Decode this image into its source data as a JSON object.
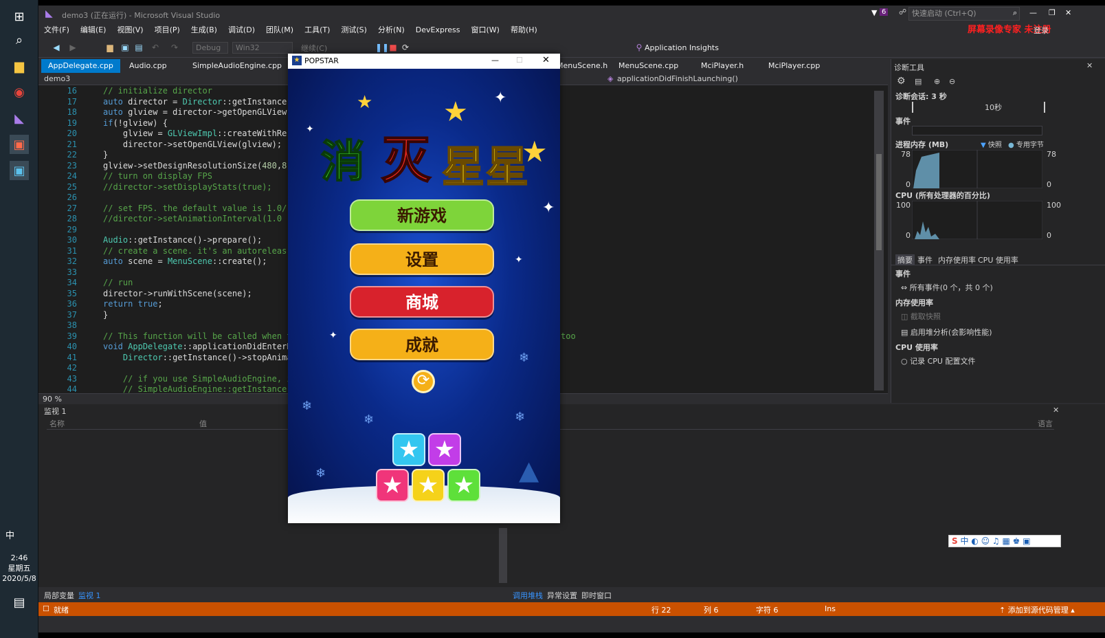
{
  "taskbar": {
    "clock_time": "2:46",
    "clock_day": "星期五",
    "clock_date": "2020/5/8",
    "ime_label": "中"
  },
  "titlebar": {
    "title": "demo3 (正在运行) - Microsoft Visual Studio",
    "notification_count": "6",
    "quick_launch_placeholder": "快速启动 (Ctrl+Q)",
    "watermark": "屏幕录像专家 未注册",
    "login_label": "登录"
  },
  "menu": [
    "文件(F)",
    "编辑(E)",
    "视图(V)",
    "项目(P)",
    "生成(B)",
    "调试(D)",
    "团队(M)",
    "工具(T)",
    "测试(S)",
    "分析(N)",
    "DevExpress",
    "窗口(W)",
    "帮助(H)"
  ],
  "toolbar": {
    "config": "Debug",
    "platform": "Win32",
    "continue_label": "继续(C)",
    "app_insights": "Application Insights"
  },
  "doc_tabs": [
    "AppDelegate.cpp",
    "Audio.cpp",
    "SimpleAudioEngine.cpp",
    "MenuScene.h",
    "MenuScene.cpp",
    "MciPlayer.h",
    "MciPlayer.cpp"
  ],
  "navbar": {
    "project": "demo3",
    "member": "applicationDidFinishLaunching()"
  },
  "code_lines": [
    {
      "n": "16",
      "html": "<span class='cm'>// initialize director</span>"
    },
    {
      "n": "17",
      "html": "<span class='kw'>auto</span> director = <span class='ty'>Director</span>::getInstance"
    },
    {
      "n": "18",
      "html": "<span class='kw'>auto</span> glview = director->getOpenGLView"
    },
    {
      "n": "19",
      "html": "<span class='kw'>if</span>(!glview) {"
    },
    {
      "n": "20",
      "html": "    glview = <span class='ty'>GLViewImpl</span>::createWithRe"
    },
    {
      "n": "21",
      "html": "    director->setOpenGLView(glview);"
    },
    {
      "n": "22",
      "html": "}"
    },
    {
      "n": "23",
      "html": "glview->setDesignResolutionSize(<span class='nm'>480</span>,<span class='nm'>8</span>"
    },
    {
      "n": "24",
      "html": "<span class='cm'>// turn on display FPS</span>"
    },
    {
      "n": "25",
      "html": "<span class='cm'>//director->setDisplayStats(true);</span>"
    },
    {
      "n": "26",
      "html": ""
    },
    {
      "n": "27",
      "html": "<span class='cm'>// set FPS. the default value is 1.0/</span>"
    },
    {
      "n": "28",
      "html": "<span class='cm'>//director->setAnimationInterval(1.0</span>"
    },
    {
      "n": "29",
      "html": ""
    },
    {
      "n": "30",
      "html": "<span class='ty'>Audio</span>::getInstance()->prepare();"
    },
    {
      "n": "31",
      "html": "<span class='cm'>// create a scene. it's an autoreleas</span>"
    },
    {
      "n": "32",
      "html": "<span class='kw'>auto</span> scene = <span class='ty'>MenuScene</span>::create();"
    },
    {
      "n": "33",
      "html": ""
    },
    {
      "n": "34",
      "html": "<span class='cm'>// run</span>"
    },
    {
      "n": "35",
      "html": "director->runWithScene(scene);"
    },
    {
      "n": "36",
      "html": "<span class='kw'>return</span> <span class='kw'>true</span>;"
    },
    {
      "n": "37",
      "html": "}"
    },
    {
      "n": "38",
      "html": ""
    },
    {
      "n": "39",
      "html": "<span class='cm'>// This function will be called when the</span>"
    },
    {
      "n": "40",
      "html": "<span class='kw'>void</span> <span class='ty'>AppDelegate</span>::applicationDidEnterBack"
    },
    {
      "n": "41",
      "html": "    <span class='ty'>Director</span>::getInstance()->stopAnimatio"
    },
    {
      "n": "42",
      "html": ""
    },
    {
      "n": "43",
      "html": "    <span class='cm'>// if you use SimpleAudioEngine, it m</span>"
    },
    {
      "n": "44",
      "html": "    <span class='cm'>// SimpleAudioEngine::getInstance()-></span>"
    }
  ],
  "code_overflow": "too",
  "zoom": "90 %",
  "diag": {
    "title": "诊断工具",
    "session": "诊断会话: 3 秒",
    "timeline_mark": "10秒",
    "events_label": "事件",
    "memory_label": "进程内存 (MB)",
    "memory_legend_snapshot": "快照",
    "memory_legend_private": "专用字节",
    "memory_max": "78",
    "memory_min": "0",
    "cpu_label": "CPU (所有处理器的百分比)",
    "cpu_max": "100",
    "cpu_min": "0",
    "tabs": [
      "摘要",
      "事件",
      "内存使用率",
      "CPU 使用率"
    ],
    "sec_events": "事件",
    "all_events": "所有事件(0 个，共 0 个)",
    "sec_memory": "内存使用率",
    "take_snapshot": "截取快照",
    "heap_analysis": "启用堆分析(会影响性能)",
    "sec_cpu": "CPU 使用率",
    "record_cpu": "记录 CPU 配置文件"
  },
  "watch": {
    "title": "监视 1",
    "col_name": "名称",
    "col_value": "值",
    "col_lang": "语言"
  },
  "bottom_tabs_left": [
    "局部变量",
    "监视 1"
  ],
  "bottom_tabs_right": [
    "调用堆栈",
    "异常设置",
    "即时窗口"
  ],
  "status": {
    "ready": "就绪",
    "row": "行 22",
    "col": "列 6",
    "char": "字符 6",
    "ins": "Ins",
    "source_control": "添加到源代码管理"
  },
  "game": {
    "window_title": "POPSTAR",
    "logo": [
      "消",
      "灭",
      "星",
      "星"
    ],
    "buttons": [
      "新游戏",
      "设置",
      "商城",
      "成就"
    ],
    "colors": {
      "green": "#7ed43a",
      "yellow": "#f5b018",
      "red": "#d8222c",
      "logo_green": "#3ddc2a",
      "logo_red": "#e0281e",
      "logo_yellow": "#ffe21a"
    },
    "blocks_top": [
      {
        "color": "#33c6f0"
      },
      {
        "color": "#c23de8"
      }
    ],
    "blocks_bottom": [
      {
        "color": "#f0357a"
      },
      {
        "color": "#f5d21a"
      },
      {
        "color": "#5ee03a"
      }
    ]
  },
  "icons": {
    "windows": "⊞",
    "search": "⌕",
    "folder": "▆",
    "chrome": "◉",
    "vs": "◣",
    "app": "▣",
    "gear": "⚙",
    "refresh": "⟳",
    "star": "★",
    "close": "✕",
    "minimize": "—",
    "maximize": "☐"
  }
}
